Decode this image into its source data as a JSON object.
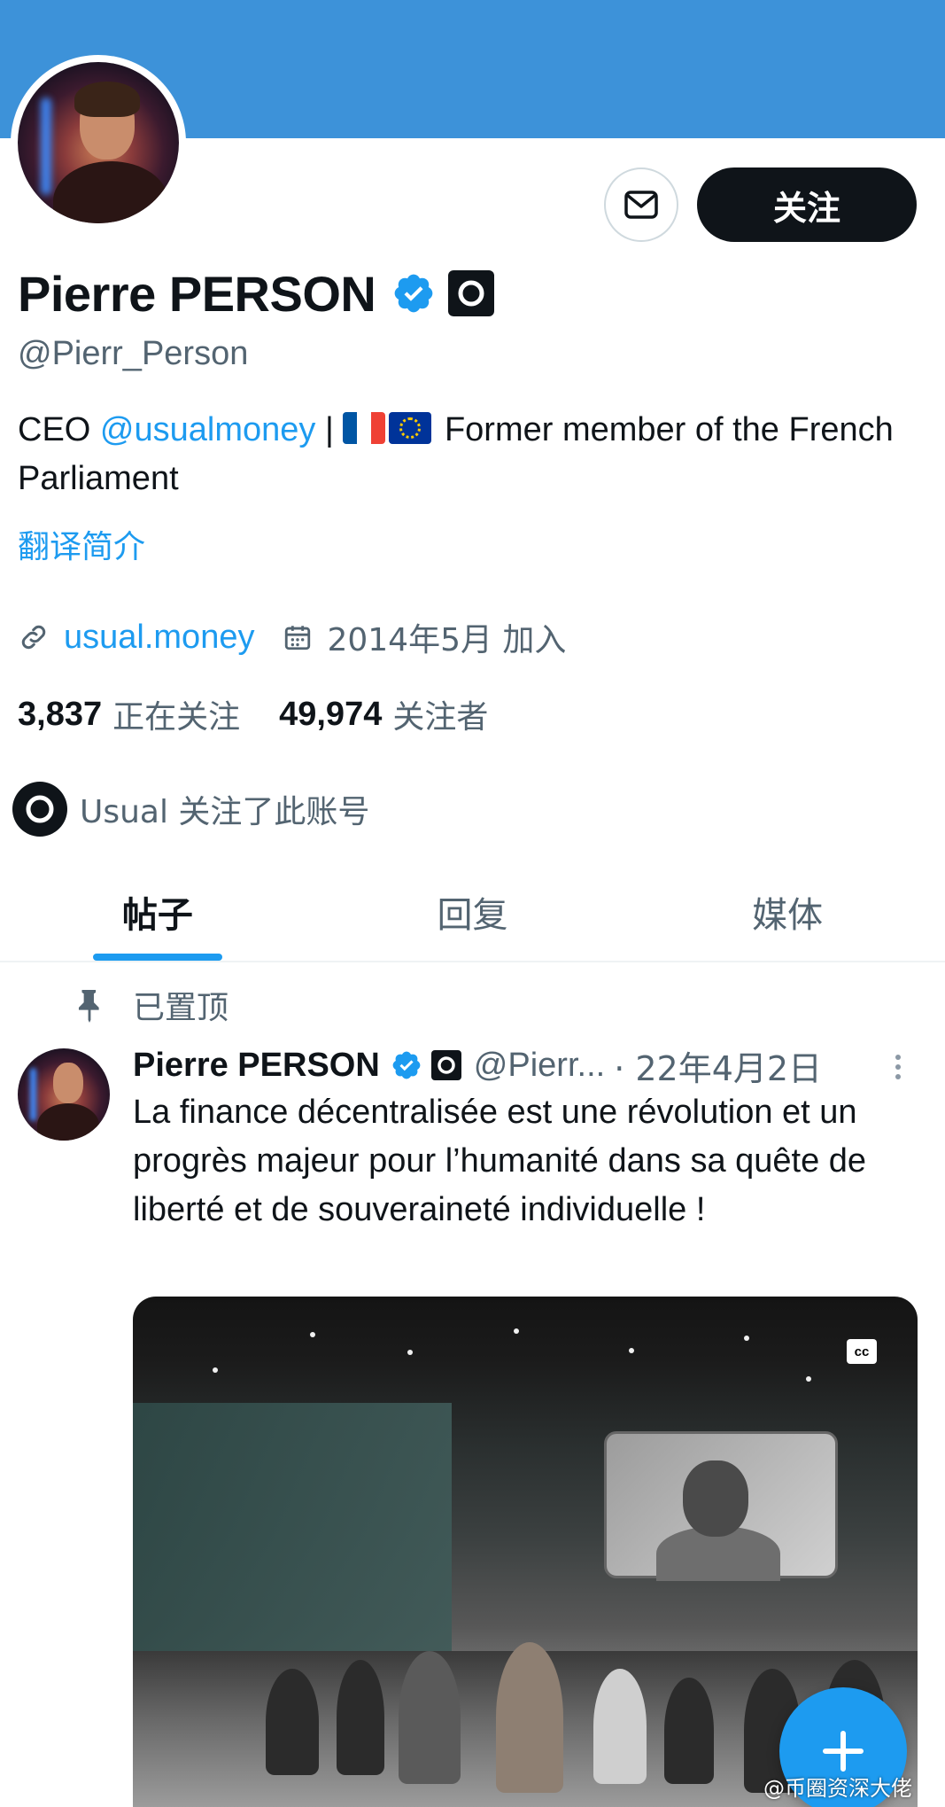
{
  "profile": {
    "name": "Pierre PERSON",
    "handle": "@Pierr_Person",
    "follow_label": "关注",
    "bio_prefix": "CEO ",
    "bio_mention": "@usualmoney",
    "bio_suffix": " | ",
    "bio_rest": " Former member of the French Parliament",
    "translate_label": "翻译简介",
    "website": "usual.money",
    "joined": "2014年5月 加入",
    "following_count": "3,837",
    "following_label": "正在关注",
    "followers_count": "49,974",
    "followers_label": "关注者",
    "followed_by_text": "Usual 关注了此账号"
  },
  "tabs": [
    {
      "label": "帖子",
      "active": true
    },
    {
      "label": "回复",
      "active": false
    },
    {
      "label": "媒体",
      "active": false
    }
  ],
  "pinned_post": {
    "pinned_label": "已置顶",
    "author_name": "Pierre PERSON",
    "author_handle": "@Pierr...",
    "date": "· 22年4月2日",
    "text": "La finance décentralisée est une révolution et un progrès majeur pour l’humanité dans sa quête de liberté et de souveraineté individuelle !",
    "media_badge": "cc"
  },
  "watermark": "@币圈资深大佬",
  "colors": {
    "banner": "#3d92d9",
    "accent": "#1d9bf0",
    "primary_text": "#0f1419",
    "secondary_text": "#536471"
  },
  "icons": {
    "message": "envelope-icon",
    "verified": "verified-badge-icon",
    "affiliation": "usual-logo-icon",
    "link": "link-icon",
    "calendar": "calendar-icon",
    "pin": "pin-icon",
    "more": "more-vertical-icon",
    "compose": "plus-icon"
  }
}
